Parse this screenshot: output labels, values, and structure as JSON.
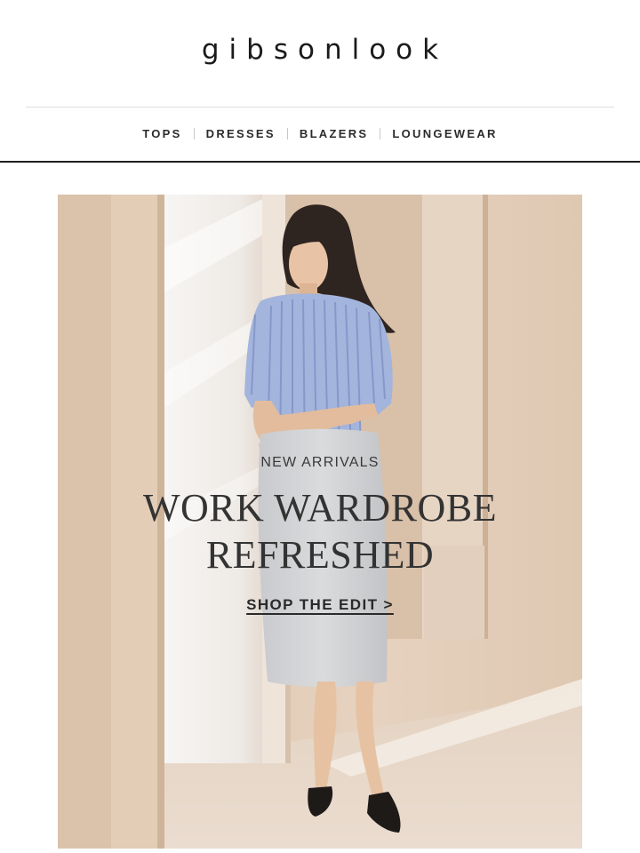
{
  "brand": {
    "name": "gibsonlook"
  },
  "nav": {
    "items": [
      {
        "label": "TOPS"
      },
      {
        "label": "DRESSES"
      },
      {
        "label": "BLAZERS"
      },
      {
        "label": "LOUNGEWEAR"
      }
    ]
  },
  "hero": {
    "eyebrow": "NEW ARRIVALS",
    "headline_line1": "WORK WARDROBE",
    "headline_line2": "REFRESHED",
    "cta": "SHOP THE EDIT >",
    "colors": {
      "background": "#e2cdb8",
      "blouse": "#9fb1dc",
      "skirt": "#d4d5d7",
      "text": "#333333"
    }
  }
}
